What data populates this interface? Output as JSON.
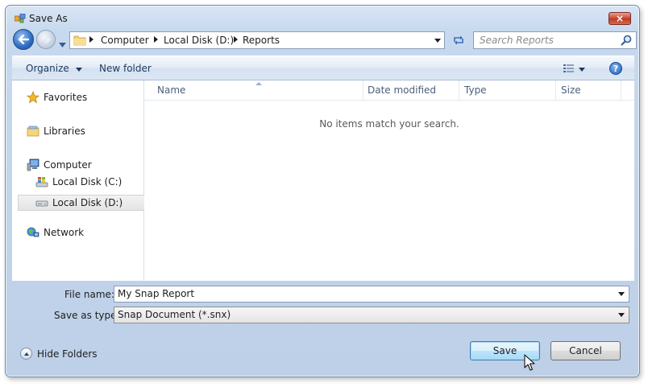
{
  "window": {
    "title": "Save As",
    "close_glyph": "×"
  },
  "address": {
    "crumbs": [
      "Computer",
      "Local Disk (D:)",
      "Reports"
    ],
    "search_placeholder": "Search Reports"
  },
  "toolbar": {
    "organize_label": "Organize",
    "new_folder_label": "New folder",
    "help_glyph": "?"
  },
  "nav": {
    "items": [
      {
        "label": "Favorites",
        "icon": "star-icon"
      },
      {
        "label": "Libraries",
        "icon": "libraries-icon"
      },
      {
        "label": "Computer",
        "icon": "computer-icon"
      },
      {
        "label": "Local Disk (C:)",
        "icon": "drive-c-icon"
      },
      {
        "label": "Local Disk (D:)",
        "icon": "drive-d-icon",
        "selected": true
      },
      {
        "label": "Network",
        "icon": "network-icon"
      }
    ]
  },
  "content": {
    "columns": [
      "Name",
      "Date modified",
      "Type",
      "Size"
    ],
    "empty_message": "No items match your search."
  },
  "form": {
    "file_name_label": "File name:",
    "file_name_value": "My Snap Report",
    "type_label": "Save as type:",
    "type_value": "Snap Document (*.snx)"
  },
  "footer": {
    "hide_folders_label": "Hide Folders",
    "save_label": "Save",
    "cancel_label": "Cancel"
  },
  "colors": {
    "accent": "#2f6cc4",
    "close": "#c9452f",
    "frame": "#c7d9ee"
  }
}
